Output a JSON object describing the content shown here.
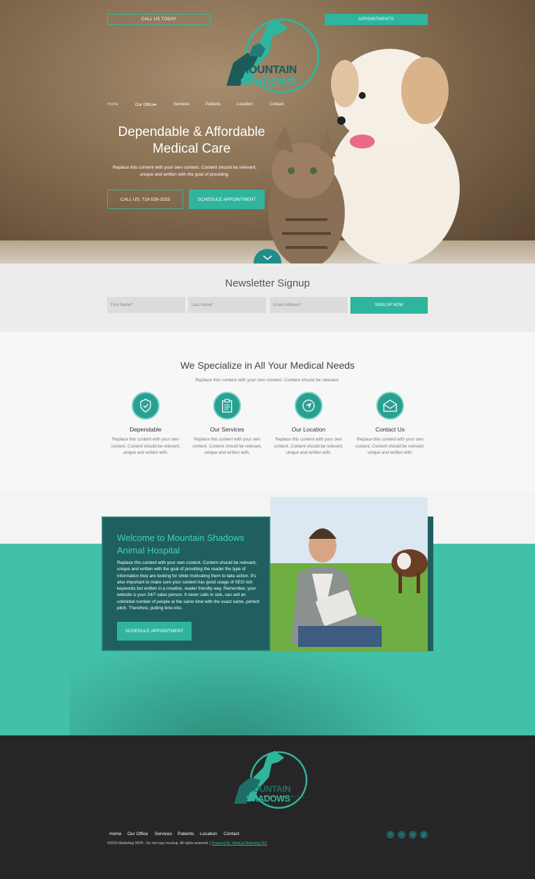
{
  "header": {
    "call_btn": "CALL US TODAY",
    "appt_btn": "APPOINTMENTS",
    "logo_name_a": "MOUNTAIN ",
    "logo_name_b": "SHADOWS",
    "logo_sub": "ANIMAL HOSPITAL",
    "nav": [
      "Home",
      "Our Office",
      "Services",
      "Patients",
      "Location",
      "Contact"
    ],
    "nav_dropdown_glyph": "▾"
  },
  "hero": {
    "title_line1": "Dependable & Affordable",
    "title_line2": "Medical Care",
    "text": "Replace this content with your own content. Content should be relevant, unique and written with the goal of providing.",
    "call_btn": "CALL US: 719-539-2533",
    "schedule_btn": "SCHEDULE APPOINTMENT"
  },
  "newsletter": {
    "title": "Newsletter Signup",
    "first_name_placeholder": "First Name*",
    "last_name_placeholder": "Last Name*",
    "email_placeholder": "Email Address*",
    "signup_btn": "SIGN UP NOW"
  },
  "specialize": {
    "title": "We Specialize in All Your Medical Needs",
    "subtitle": "Replace this content with your own content. Content should be relevant.",
    "features": [
      {
        "title": "Dependable",
        "text": "Replace this content with your own content. Content should be relevant, unique and written with.",
        "icon": "shield-icon"
      },
      {
        "title": "Our Services",
        "text": "Replace this content with your own content. Content should be relevant, unique and written with.",
        "icon": "clipboard-icon"
      },
      {
        "title": "Our Location",
        "text": "Replace this content with your own content. Content should be relevant, unique and written with.",
        "icon": "location-icon"
      },
      {
        "title": "Contact Us",
        "text": "Replace this content with your own content. Content should be relevant, unique and written with.",
        "icon": "envelope-icon"
      }
    ]
  },
  "welcome": {
    "title": "Welcome to Mountain Shadows Animal Hospital",
    "text": "Replace this content with your own content. Content should be relevant, unique and written with the goal of providing the reader the type of information they are looking for while motivating them to take action. It's also important to make sure your content has good usage of SEO rich keywords but written in a creative, reader friendly way. Remember, your website is your 24/7 sales person. It never calls in sick, can sell an unlimited number of people at the same time with the exact same, perfect pitch. Therefore, putting time into.",
    "schedule_btn": "SCHEDULE APPOINTMENT"
  },
  "footer": {
    "logo_name_a": "MOUNTAIN ",
    "logo_name_b": "SHADOWS",
    "logo_sub": "ANIMAL HOSPITAL",
    "nav": [
      "Home",
      "Our Office",
      "Services",
      "Patients",
      "Location",
      "Contact"
    ],
    "copyright": "©2016 Marketing 360® - Do not copy mockup. All rights reserved. |",
    "powered_by": "Powered By: Medical Marketing 360",
    "social": [
      {
        "icon": "facebook-icon",
        "glyph": "f"
      },
      {
        "icon": "twitter-icon",
        "glyph": "t"
      },
      {
        "icon": "vimeo-icon",
        "glyph": "v"
      },
      {
        "icon": "pinterest-icon",
        "glyph": "p"
      }
    ]
  },
  "colors": {
    "accent": "#2fb59d",
    "dark_teal": "#1f5f60",
    "band": "#43c0a8",
    "footer": "#262626"
  }
}
